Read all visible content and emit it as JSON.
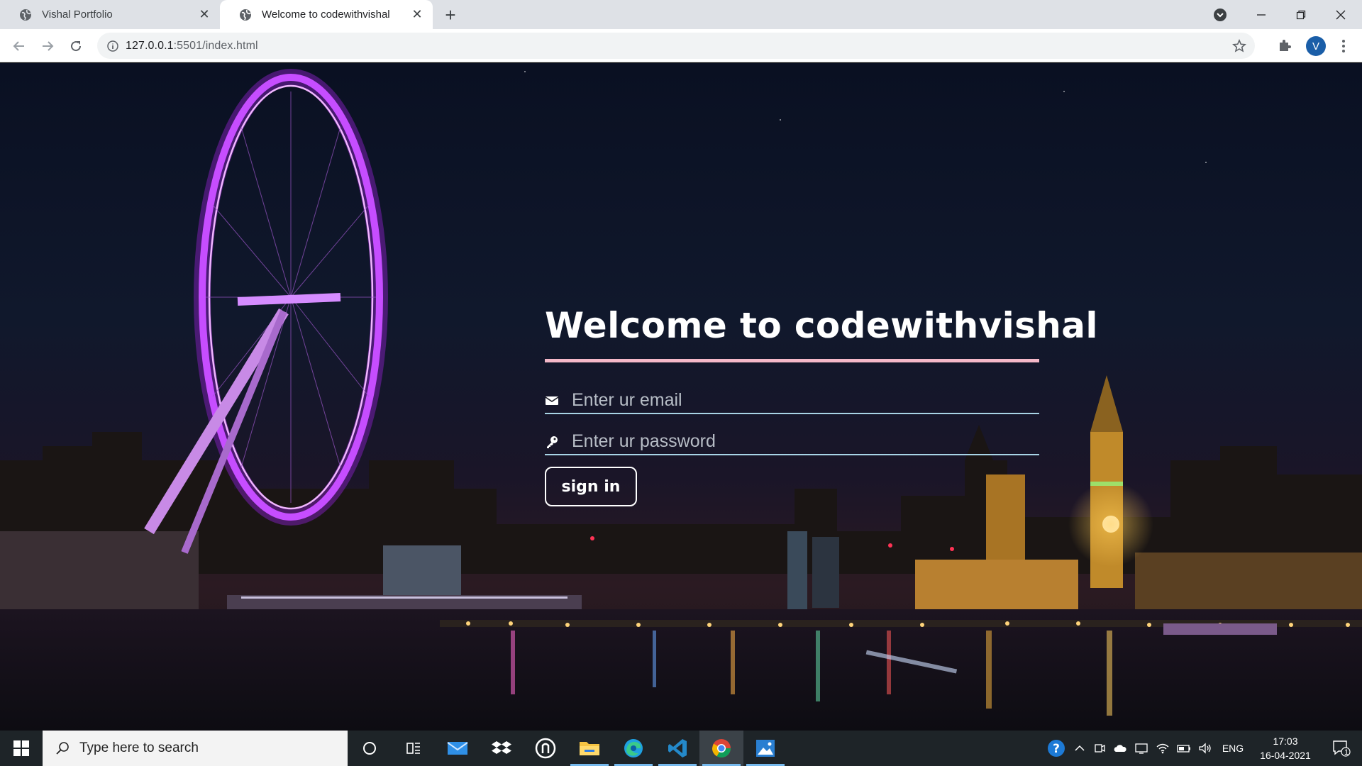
{
  "browser": {
    "tabs": [
      {
        "title": "Vishal Portfolio",
        "active": false
      },
      {
        "title": "Welcome to codewithvishal",
        "active": true
      }
    ],
    "new_tab_symbol": "+",
    "close_symbol": "✕",
    "address": {
      "host": "127.0.0.1",
      "rest": ":5501/index.html"
    },
    "profile_initial": "V",
    "icons": [
      "globe-icon",
      "tab-search-icon",
      "minimize-icon",
      "restore-icon",
      "close-icon",
      "back-icon",
      "forward-icon",
      "reload-icon",
      "info-icon",
      "star-icon",
      "puzzle-icon",
      "kebab-menu-icon"
    ]
  },
  "page": {
    "heading": "Welcome to codewithvishal",
    "email_placeholder": "Enter ur email",
    "password_placeholder": "Enter ur password",
    "signin_label": "sign in",
    "accent": "#f4b8c8",
    "underline": "#a8d4e6"
  },
  "taskbar": {
    "search_placeholder": "Type here to search",
    "language": "ENG",
    "time": "17:03",
    "date": "16-04-2021",
    "notification_count": "1",
    "apps": [
      "cortana-icon",
      "task-view-icon",
      "mail-icon",
      "dropbox-icon",
      "app-icon",
      "file-explorer-icon",
      "edge-icon",
      "vscode-icon",
      "chrome-icon",
      "photos-icon"
    ]
  }
}
